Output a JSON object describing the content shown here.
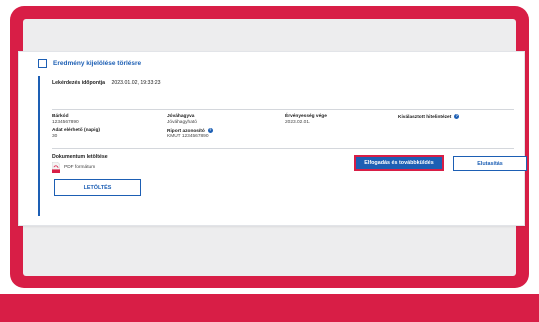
{
  "colors": {
    "brand_red": "#d81e46",
    "primary_blue": "#1d5fb4"
  },
  "header": {
    "title": "Eredmény kijelölése törlésre"
  },
  "query": {
    "label": "Lekérdezés időpontja",
    "value": "2023.01.02, 19:33:23"
  },
  "fields": {
    "barcode": {
      "label": "Bárkód",
      "value": "1234567890"
    },
    "approved": {
      "label": "Jóváhagyva",
      "value": "Jóváhagyható"
    },
    "validity": {
      "label": "Érvényesség vége",
      "value": "2023.02.01."
    },
    "institution": {
      "label": "Kiválasztott hitelintézet",
      "value": ""
    },
    "days": {
      "label": "Adat elérhető (napig)",
      "value": "30"
    },
    "report_id": {
      "label": "Riport azonosító",
      "value": "KMUT 1234567890"
    }
  },
  "document": {
    "label": "Dokumentum letöltése",
    "format": "PDF formátum",
    "icon": "pdf-icon",
    "download_button": "LETÖLTÉS"
  },
  "actions": {
    "accept_button": "Elfogadás és továbbküldés",
    "reject_button": "Elutasítás"
  }
}
